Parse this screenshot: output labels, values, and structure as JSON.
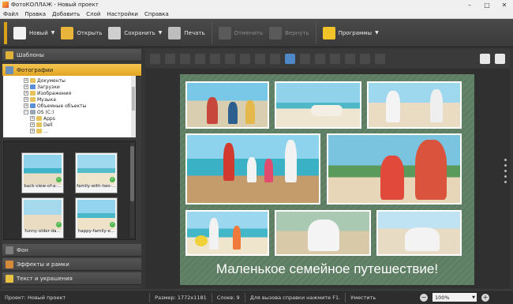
{
  "window": {
    "title": "ФотоКОЛЛАЖ - Новый проект"
  },
  "menu": [
    "Файл",
    "Правка",
    "Добавить",
    "Слой",
    "Настройки",
    "Справка"
  ],
  "toolbar": {
    "new_label": "Новый",
    "open_label": "Открыть",
    "save_label": "Сохранить",
    "print_label": "Печать",
    "undo_label": "Отменить",
    "redo_label": "Вернуть",
    "programs_label": "Программы"
  },
  "left_panel": {
    "templates_label": "Шаблоны",
    "photos_label": "Фотографии",
    "background_label": "Фон",
    "effects_label": "Эффекты и рамки",
    "text_label": "Текст и украшения"
  },
  "tree": [
    "Документы",
    "Загрузки",
    "Изображения",
    "Музыка",
    "Объемные объекты",
    "OS (C:)",
    "Apps",
    "Dell",
    "…"
  ],
  "thumbnails": [
    "back-view-of-a-...",
    "family-with-two-...",
    "funny-older-da...",
    "happy-family-e..."
  ],
  "poster": {
    "caption": "Маленькое семейное путешествие!"
  },
  "status": {
    "project_label": "Проект:",
    "project_value": "Новый проект",
    "size_label": "Размер:",
    "size_value": "1772x1181",
    "layers_label": "Слоев:",
    "layers_value": "9",
    "help_text": "Для вызова справки нажмите F1.",
    "fit_label": "Уместить",
    "zoom_value": "100%"
  },
  "colors": {
    "accent": "#e2a521",
    "poster_bg": "#5d7e63"
  }
}
